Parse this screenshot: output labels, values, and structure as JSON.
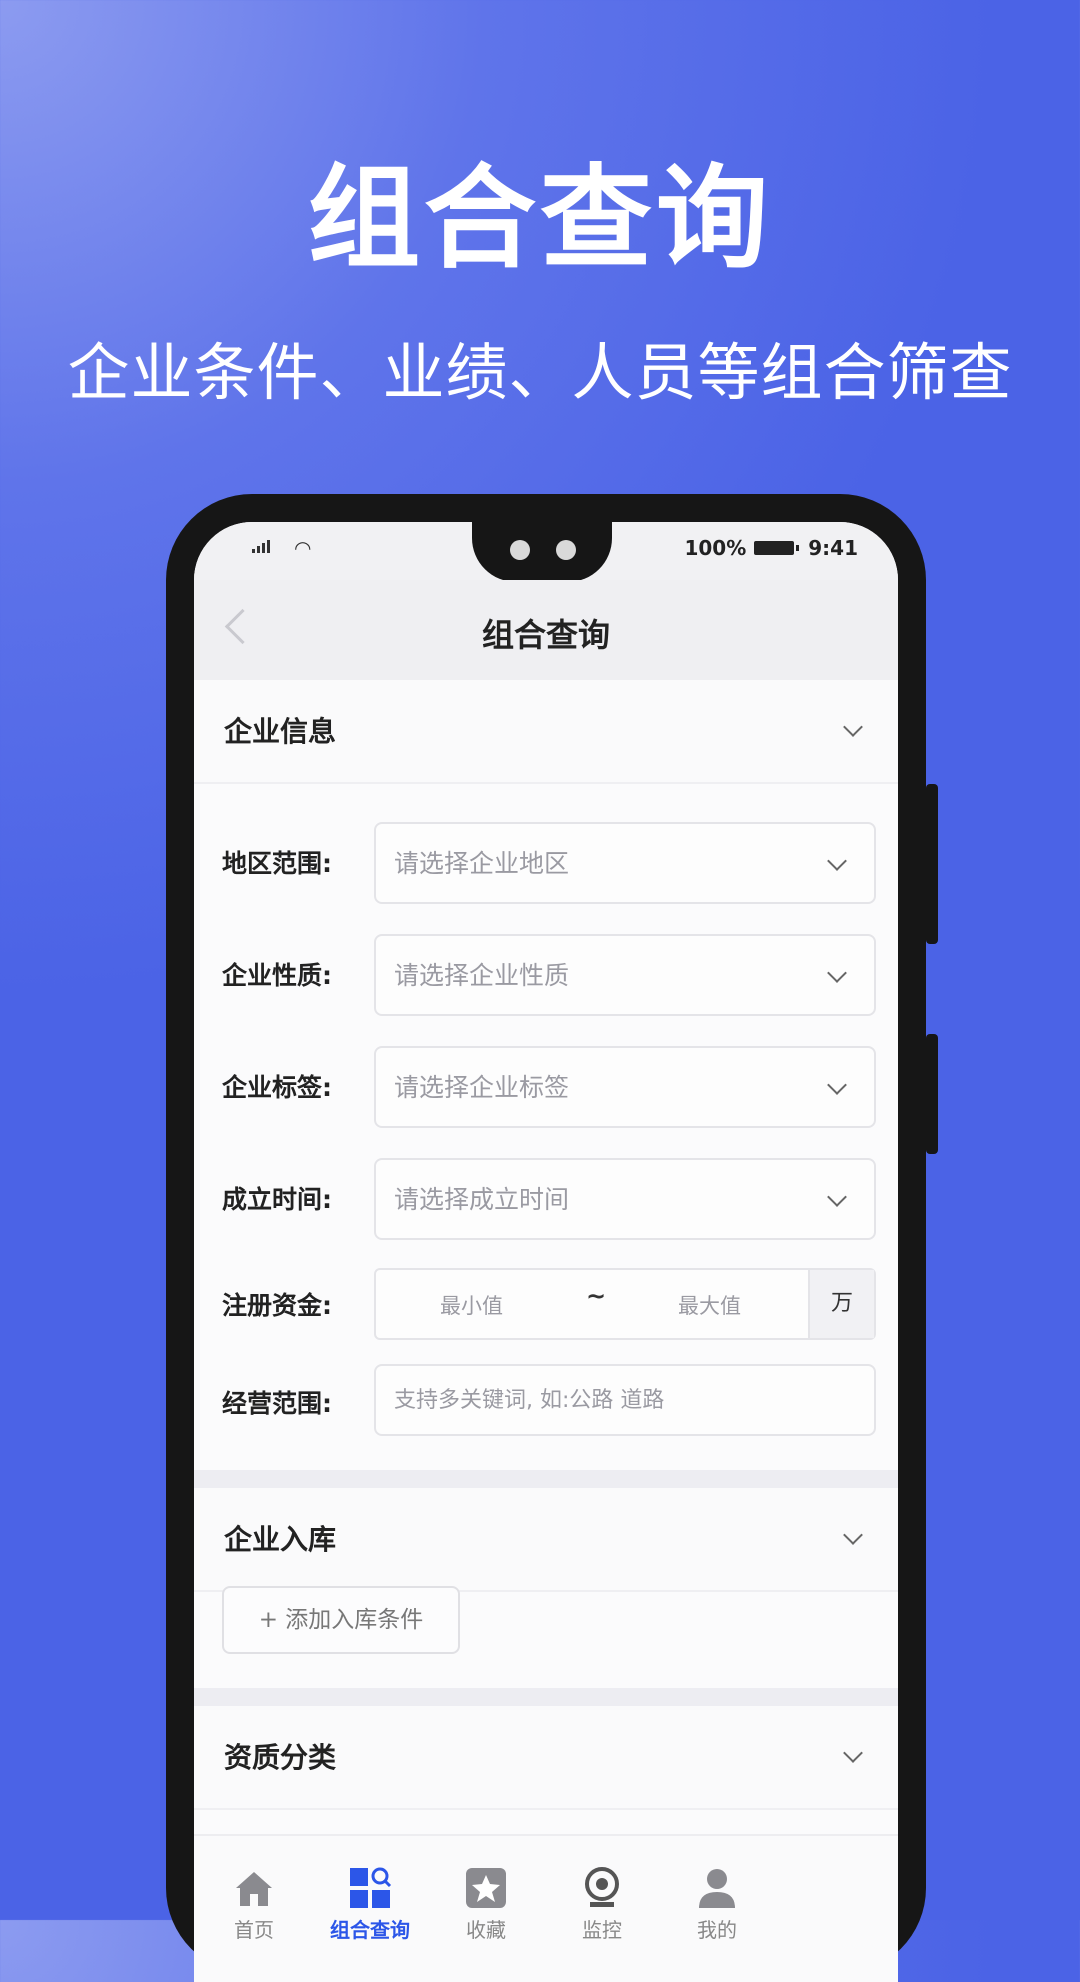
{
  "hero": {
    "title": "组合查询",
    "subtitle": "企业条件、业绩、人员等组合筛查"
  },
  "status_bar": {
    "battery": "100%",
    "time": "9:41"
  },
  "nav": {
    "title": "组合查询"
  },
  "sections": {
    "enterprise_info": {
      "label": "企业信息"
    },
    "enterprise_storage": {
      "label": "企业入库"
    },
    "qualification": {
      "label": "资质分类"
    }
  },
  "fields": {
    "region": {
      "label": "地区范围:",
      "placeholder": "请选择企业地区"
    },
    "nature": {
      "label": "企业性质:",
      "placeholder": "请选择企业性质"
    },
    "tags": {
      "label": "企业标签:",
      "placeholder": "请选择企业标签"
    },
    "founded": {
      "label": "成立时间:",
      "placeholder": "请选择成立时间"
    },
    "capital": {
      "label": "注册资金:",
      "min": "最小值",
      "sep": "~",
      "max": "最大值",
      "unit": "万"
    },
    "scope": {
      "label": "经营范围:",
      "placeholder": "支持多关键词, 如:公路 道路"
    }
  },
  "add_condition": {
    "label": "+ 添加入库条件"
  },
  "tabs": [
    {
      "label": "首页",
      "icon": "home-icon",
      "active": false
    },
    {
      "label": "组合查询",
      "icon": "grid-search-icon",
      "active": true
    },
    {
      "label": "收藏",
      "icon": "star-icon",
      "active": false
    },
    {
      "label": "监控",
      "icon": "camera-icon",
      "active": false
    },
    {
      "label": "我的",
      "icon": "person-icon",
      "active": false
    }
  ],
  "colors": {
    "background": "#4b63e6",
    "accent": "#2c56e8"
  }
}
